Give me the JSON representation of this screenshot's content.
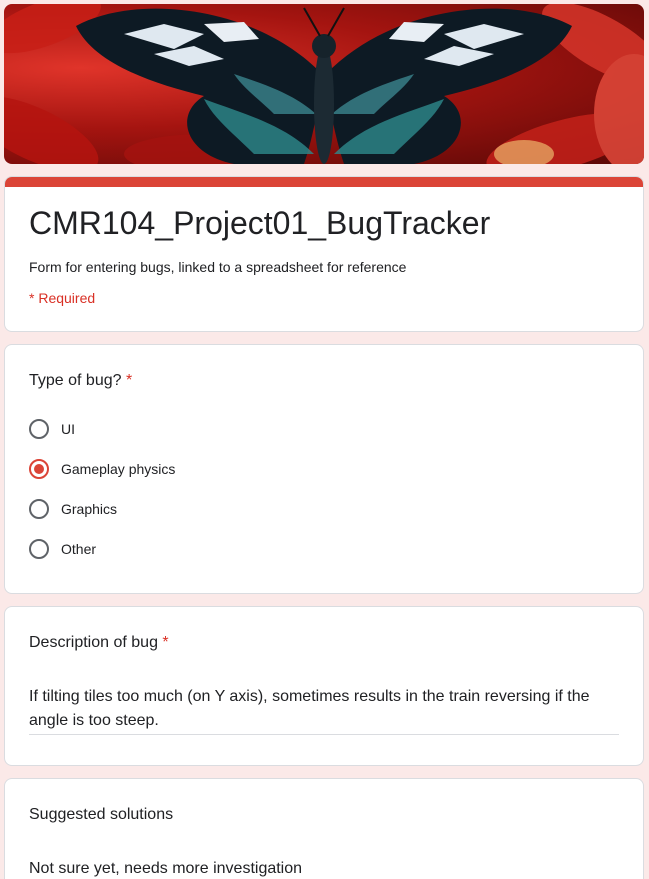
{
  "form": {
    "title": "CMR104_Project01_BugTracker",
    "description": "Form for entering bugs, linked to a spreadsheet for reference",
    "required_note": "* Required",
    "accent_color": "#db4437",
    "background_color": "#fbe9e8"
  },
  "questions": {
    "type_of_bug": {
      "title": "Type of bug?",
      "required_mark": "*",
      "options": [
        {
          "label": "UI",
          "selected": false
        },
        {
          "label": "Gameplay physics",
          "selected": true
        },
        {
          "label": "Graphics",
          "selected": false
        },
        {
          "label": "Other",
          "selected": false
        }
      ]
    },
    "description": {
      "title": "Description of bug",
      "required_mark": "*",
      "answer": "If tilting tiles too much (on Y axis), sometimes results in the train reversing if the angle is too steep."
    },
    "suggested_solutions": {
      "title": "Suggested solutions",
      "answer": "Not sure yet, needs more investigation"
    }
  }
}
